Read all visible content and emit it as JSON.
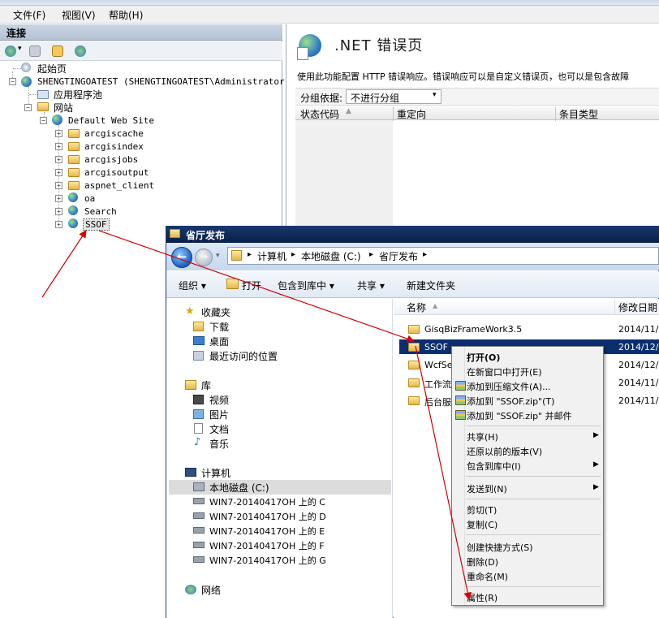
{
  "menubar": {
    "items": [
      "文件(F)",
      "视图(V)",
      "帮助(H)"
    ]
  },
  "connections": {
    "title": "连接",
    "tree": {
      "start_page": "起始页",
      "server": "SHENGTINGOATEST (SHENGTINGOATEST\\Administrator)",
      "app_pools": "应用程序池",
      "sites": "网站",
      "default_site": "Default Web Site",
      "children": [
        "arcgiscache",
        "arcgisindex",
        "arcgisjobs",
        "arcgisoutput",
        "aspnet_client",
        "oa",
        "Search",
        "SSOF"
      ]
    }
  },
  "feature": {
    "title": ".NET 错误页",
    "description": "使用此功能配置 HTTP 错误响应。错误响应可以是自定义错误页，也可以是包含故障",
    "group_by_label": "分组依据:",
    "group_by_value": "不进行分组",
    "columns": [
      "状态代码",
      "重定向",
      "条目类型"
    ]
  },
  "explorer": {
    "title": "省厅发布",
    "breadcrumb": [
      "计算机",
      "本地磁盘 (C:)",
      "省厅发布"
    ],
    "toolbar": {
      "organize": "组织",
      "open": "打开",
      "include": "包含到库中",
      "share": "共享",
      "new_folder": "新建文件夹"
    },
    "nav": {
      "favorites": "收藏夹",
      "downloads": "下载",
      "desktop": "桌面",
      "recent": "最近访问的位置",
      "libraries": "库",
      "videos": "视频",
      "pictures": "图片",
      "documents": "文档",
      "music": "音乐",
      "computer": "计算机",
      "local_disk": "本地磁盘 (C:)",
      "net_drives": [
        "WIN7-20140417OH 上的 C",
        "WIN7-20140417OH 上的 D",
        "WIN7-20140417OH 上的 E",
        "WIN7-20140417OH 上的 F",
        "WIN7-20140417OH 上的 G"
      ],
      "network": "网络"
    },
    "columns": {
      "name": "名称",
      "modified": "修改日期"
    },
    "files": [
      {
        "name": "GisqBizFrameWork3.5",
        "date": "2014/11/"
      },
      {
        "name": "SSOF",
        "date": "2014/12/"
      },
      {
        "name": "WcfSer",
        "date": "2014/12/"
      },
      {
        "name": "工作流",
        "date": "2014/11/"
      },
      {
        "name": "后台服",
        "date": "2014/11/"
      }
    ]
  },
  "context_menu": {
    "items": [
      "打开(O)",
      "在新窗口中打开(E)",
      "添加到压缩文件(A)...",
      "添加到 \"SSOF.zip\"(T)",
      "添加到 \"SSOF.zip\" 并邮件",
      "共享(H)",
      "还原以前的版本(V)",
      "包含到库中(I)",
      "发送到(N)",
      "剪切(T)",
      "复制(C)",
      "创建快捷方式(S)",
      "删除(D)",
      "重命名(M)",
      "属性(R)"
    ]
  },
  "colors": {
    "title_bar": "#0a1f4b",
    "selection": "#0b2e6f",
    "annotation_arrow": "#d40000"
  }
}
